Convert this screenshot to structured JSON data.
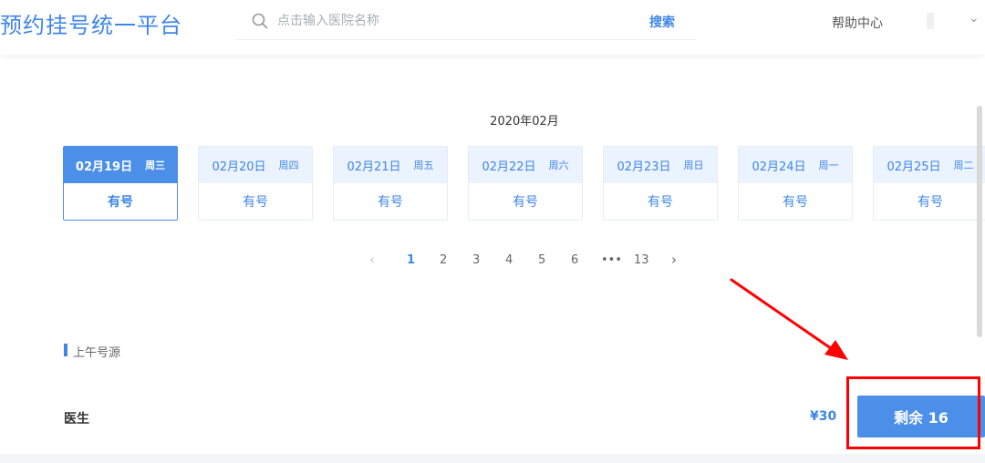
{
  "header": {
    "logo": "预约挂号统一平台",
    "search": {
      "placeholder": "点击输入医院名称",
      "button_label": "搜索"
    },
    "help_label": "帮助中心"
  },
  "calendar": {
    "month_title": "2020年02月",
    "days": [
      {
        "date": "02月19日",
        "weekday": "周三",
        "status": "有号",
        "selected": true
      },
      {
        "date": "02月20日",
        "weekday": "周四",
        "status": "有号",
        "selected": false
      },
      {
        "date": "02月21日",
        "weekday": "周五",
        "status": "有号",
        "selected": false
      },
      {
        "date": "02月22日",
        "weekday": "周六",
        "status": "有号",
        "selected": false
      },
      {
        "date": "02月23日",
        "weekday": "周日",
        "status": "有号",
        "selected": false
      },
      {
        "date": "02月24日",
        "weekday": "周一",
        "status": "有号",
        "selected": false
      },
      {
        "date": "02月25日",
        "weekday": "周二",
        "status": "有号",
        "selected": false
      }
    ]
  },
  "pagination": {
    "pages": [
      "1",
      "2",
      "3",
      "4",
      "5",
      "6",
      "•••",
      "13"
    ],
    "current": "1"
  },
  "session": {
    "title": "上午号源",
    "doctor_label": "医生",
    "price": "¥30",
    "remain_label": "剩余 16"
  },
  "colors": {
    "accent": "#3f86e8",
    "selected_card": "#4b8fe9",
    "annotation": "#ff0000"
  },
  "icons": [
    "search-icon",
    "chevron-down-icon",
    "prev-page-icon",
    "next-page-icon",
    "red-arrow-icon"
  ]
}
